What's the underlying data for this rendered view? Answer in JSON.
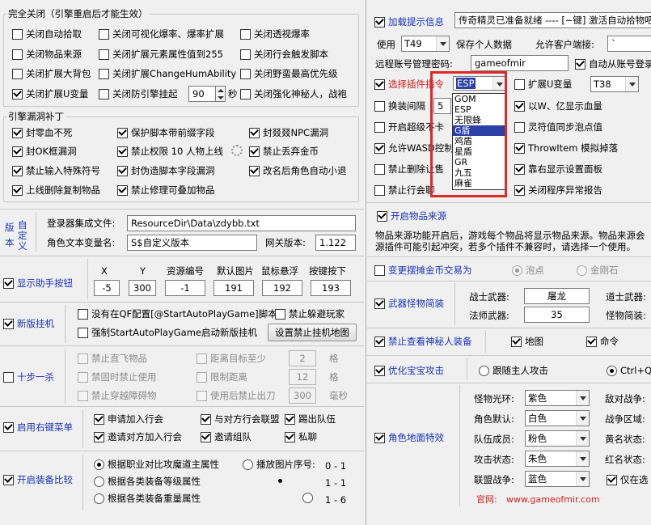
{
  "left": {
    "disable_group": {
      "title": "完全关闭（引擎重启后才能生效）",
      "items": [
        {
          "label": "关闭自动拾取",
          "checked": false
        },
        {
          "label": "关闭可视化爆率、爆率扩展",
          "checked": false
        },
        {
          "label": "关闭透视爆率",
          "checked": false
        },
        {
          "label": "关闭物品来源",
          "checked": false
        },
        {
          "label": "关闭扩展元素属性值到255",
          "checked": false
        },
        {
          "label": "关闭行会触发脚本",
          "checked": false
        },
        {
          "label": "关闭扩展大背包",
          "checked": false
        },
        {
          "label": "关闭扩展ChangeHumAbility",
          "checked": false
        },
        {
          "label": "关闭野蛮最高优先级",
          "checked": false
        },
        {
          "label": "关闭扩展U变量",
          "checked": true
        },
        {
          "label": "关闭防引擎挂起",
          "checked": false
        },
        {
          "label": "关闭强化神秘人，战袍",
          "checked": false
        }
      ],
      "hang_value": "90",
      "hang_unit": "秒"
    },
    "patch_group": {
      "title": "引擎漏洞补丁",
      "items": [
        {
          "label": "封零血不死",
          "checked": true
        },
        {
          "label": "保护脚本带前缀字段",
          "checked": true
        },
        {
          "label": "封叕叕NPC漏洞",
          "checked": true
        },
        {
          "label": "封OK框漏洞",
          "checked": true
        },
        {
          "label": "禁止权限 10 人物上线",
          "checked": true
        },
        {
          "label": "禁止丢弃金币",
          "checked": true
        },
        {
          "label": "禁止输入特殊符号",
          "checked": true
        },
        {
          "label": "封伪造脚本字段漏洞",
          "checked": true
        },
        {
          "label": "改名后角色自动小退",
          "checked": true
        },
        {
          "label": "上线删除复制物品",
          "checked": true
        },
        {
          "label": "禁止修理可叠加物品",
          "checked": true
        }
      ]
    },
    "version": {
      "side_label_1": "版本",
      "side_label_2": "自定义",
      "login_label": "登录器集成文件:",
      "login_value": "ResourceDir\\Data\\zdybb.txt",
      "role_label": "角色文本变量名:",
      "role_value": "S$自定义版本",
      "gate_label": "网关版本:",
      "gate_value": "1.122"
    },
    "helper_btn": {
      "label": "显示助手按钮",
      "checked": true,
      "headers": [
        "X",
        "Y",
        "资源编号",
        "默认图片",
        "鼠标悬浮",
        "按键按下"
      ],
      "values": [
        "-5",
        "300",
        "-1",
        "191",
        "192",
        "193"
      ]
    },
    "new_hang": {
      "label": "新版挂机",
      "checked": true,
      "opt1": "没有在QF配置[@StartAutoPlayGame]脚本",
      "opt1_checked": false,
      "opt2": "禁止躲避玩家",
      "opt2_checked": false,
      "opt3": "强制StartAutoPlayGame启动新版挂机",
      "opt3_checked": false,
      "map_button": "设置禁止挂机地图"
    },
    "ten_step": {
      "label": "十步一杀",
      "checked": false,
      "items": [
        {
          "label": "禁止直飞物品",
          "checked": false
        },
        {
          "label": "距离目标至少",
          "checked": false,
          "value": "2",
          "unit": "格"
        },
        {
          "label": "禁固时禁止使用",
          "checked": false
        },
        {
          "label": "限制距离",
          "checked": false,
          "value": "12",
          "unit": "格"
        },
        {
          "label": "禁止穿越障碍物",
          "checked": false
        },
        {
          "label": "使用后禁止出刀",
          "checked": false,
          "value": "300",
          "unit": "毫秒"
        }
      ]
    },
    "right_menu": {
      "label": "启用右键菜单",
      "checked": true,
      "items": [
        {
          "label": "申请加入行会",
          "checked": true
        },
        {
          "label": "与对方行会联盟",
          "checked": true
        },
        {
          "label": "踢出队伍",
          "checked": true
        },
        {
          "label": "邀请对方加入行会",
          "checked": true
        },
        {
          "label": "邀请组队",
          "checked": true
        },
        {
          "label": "私聊",
          "checked": true
        }
      ]
    },
    "equip_compare": {
      "label": "开启装备比较",
      "checked": true,
      "items": [
        {
          "label": "根据职业对比攻魔道主属性",
          "selected": true
        },
        {
          "label": "根据各类装备等级属性",
          "selected": false
        },
        {
          "label": "根据各类装备重量属性",
          "selected": false
        }
      ],
      "play_label": "播放图片序号:",
      "play_options": [
        {
          "label": "0 - 1",
          "selected": false
        },
        {
          "label": "1 - 1",
          "selected": true
        },
        {
          "label": "1 - 6",
          "selected": false
        }
      ]
    }
  },
  "right": {
    "load_tip": {
      "label": "加载提示信息",
      "checked": true,
      "value": "传奇精灵已准备就绪 ---- [~键] 激活自动拾物吧"
    },
    "use_label": "使用",
    "use_value": "T49",
    "save_label": "保存个人数据",
    "client_port_label": "允许客户端接:",
    "remote_label": "远程账号管理密码:",
    "remote_value": "gameofmir",
    "auto_login": {
      "label": "自动从账号登录",
      "checked": true
    },
    "plugin": {
      "label": "选择插件指令",
      "checked": true,
      "value": "ESP"
    },
    "plugin_options": [
      "GOM",
      "ESP",
      "无限蜂",
      "G盾",
      "鸡盾",
      "星盾",
      "GR",
      "九五",
      "麻雀"
    ],
    "plugin_highlight": "G盾",
    "ext_u": {
      "label": "扩展U变量",
      "checked": false,
      "value": "T38"
    },
    "left_opts": [
      {
        "label": "换装间隔",
        "checked": false,
        "value": "5"
      },
      {
        "label": "开启超级不卡",
        "checked": false
      },
      {
        "label": "允许WASD控制",
        "checked": true
      },
      {
        "label": "禁止删除让售",
        "checked": false
      },
      {
        "label": "禁止行会聊",
        "checked": false
      }
    ],
    "right_opts": [
      {
        "label": "以W、亿显示血量",
        "checked": true
      },
      {
        "label": "灵符值同步泡点值",
        "checked": false
      },
      {
        "label": "ThrowItem 模拟掉落",
        "checked": true
      },
      {
        "label": "靠右显示设置面板",
        "checked": true
      },
      {
        "label": "关闭程序异常报告",
        "checked": true
      }
    ],
    "item_source": {
      "label": "开启物品来源",
      "checked": true,
      "desc1": "物品来源功能开启后，游戏每个物品将显示物品来源。物品来源会",
      "desc2": "源插件可能引起冲突，若多个插件不兼容时，请选择一个使用。"
    },
    "stall": {
      "label": "变更摆摊金币交易为",
      "checked": false,
      "opt1": "泡点",
      "opt2": "金刚石"
    },
    "weapon": {
      "label": "武器怪物简装",
      "checked": true,
      "warrior_label": "战士武器:",
      "warrior_value": "屠龙",
      "taoist_label": "道士武器:",
      "mage_label": "法师武器:",
      "mage_value": "35",
      "monster_label": "怪物简装:"
    },
    "mystery": {
      "label": "禁止查看神秘人装备",
      "checked": true,
      "map": "地图",
      "map_checked": true,
      "cmd": "命令",
      "cmd_checked": true
    },
    "pet_attack": {
      "label": "优化宝宝攻击",
      "checked": true,
      "opt1": "跟随主人攻击",
      "opt2": "Ctrl+Q键"
    },
    "ground_effect": {
      "label": "角色地面特效",
      "checked": true,
      "rows": [
        {
          "label": "怪物光环:",
          "value": "紫色"
        },
        {
          "label": "角色默认:",
          "value": "白色"
        },
        {
          "label": "队伍成员:",
          "value": "粉色"
        },
        {
          "label": "攻击状态:",
          "value": "朱色"
        },
        {
          "label": "联盟战争:",
          "value": "蓝色"
        }
      ],
      "side_labels": [
        "敌对战争:",
        "战争区域:",
        "黄名状态:",
        "红名状态:"
      ],
      "only_label": "仅在选",
      "only_checked": true,
      "site_label": "官网:",
      "site_value": "www.gameofmir.com"
    }
  }
}
